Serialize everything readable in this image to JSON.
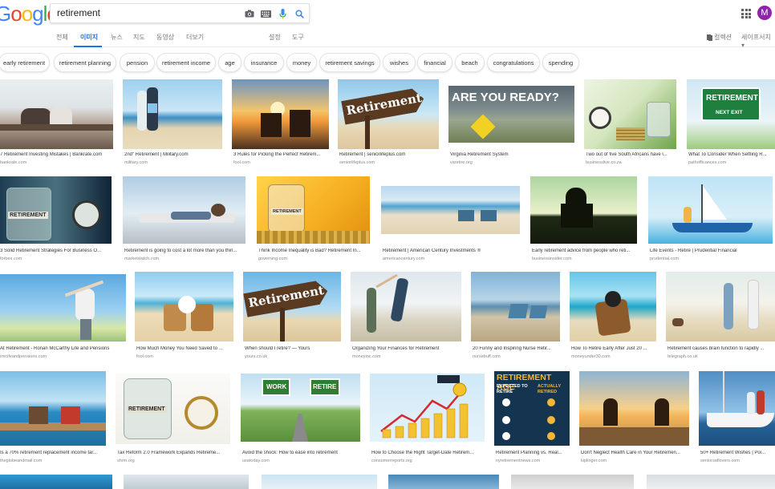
{
  "logo": "Google",
  "search": {
    "value": "retirement"
  },
  "avatar_letter": "M",
  "tabs": [
    "전체",
    "이미지",
    "뉴스",
    "지도",
    "동영상",
    "더보기"
  ],
  "right_tabs": {
    "settings": "설정",
    "tools": "도구",
    "collections": "컬렉션",
    "safesearch": "세이프서치 ▾"
  },
  "chips": [
    "early retirement",
    "retirement planning",
    "pension",
    "retirement income",
    "age",
    "insurance",
    "money",
    "retirement savings",
    "wishes",
    "financial",
    "beach",
    "congratulations",
    "spending"
  ],
  "images": {
    "r1": [
      {
        "cap": "7 Retirement Investing Mistakes | Bankrate.com",
        "src": "bankrate.com"
      },
      {
        "cap": "2nd\" Retirement | Military.com",
        "src": "military.com"
      },
      {
        "cap": "3 Rules for Picking the Perfect Retirem...",
        "src": "fool.com"
      },
      {
        "cap": "Retirement | seniorlifeplus.com",
        "src": "seniorlifeplus.com",
        "text": "Retirement"
      },
      {
        "cap": "Virginia Retirement System",
        "src": "varetire.org",
        "text": "ARE YOU READY?"
      },
      {
        "cap": "Two out of five South Africans have l...",
        "src": "businesslive.co.za"
      },
      {
        "cap": "What To Consider When Settling R...",
        "src": "pathofficances.com",
        "text": "RETIREMENT",
        "text2": "NEXT EXIT"
      }
    ],
    "r2": [
      {
        "cap": "3 Solid Retirement Strategies For Business O...",
        "src": "forbes.com",
        "text": "RETIREMENT"
      },
      {
        "cap": "Retirement is going to cost a lot more than you thin...",
        "src": "marketwatch.com"
      },
      {
        "cap": "Think Income Inequality is Bad? Retirement In...",
        "src": "governing.com",
        "text": "RETIREMENT"
      },
      {
        "cap": "Retirement | American Century Investments ®",
        "src": "americancentury.com"
      },
      {
        "cap": "Early retirement advice from people who reti...",
        "src": "businessinsider.com"
      },
      {
        "cap": "Life Events - Retire | Prudential Financial",
        "src": "prudential.com"
      }
    ],
    "r3": [
      {
        "cap": "At Retirement - Ronan McCarthy Life and Pensions",
        "src": "rmcifeandpensions.com"
      },
      {
        "cap": "How Much Money You Need Saved to ...",
        "src": "fool.com"
      },
      {
        "cap": "When should I retire? — Yours",
        "src": "yours.co.uk",
        "text": "Retirement"
      },
      {
        "cap": "Organizing Your Finances for Retirement",
        "src": "moneyinc.com"
      },
      {
        "cap": "20 Funny and Inspiring Nurse Retir...",
        "src": "nursebuff.com"
      },
      {
        "cap": "How To Retire Early After Just 20 ...",
        "src": "moneyunder30.com"
      },
      {
        "cap": "Retirement causes brain function to rapidly ...",
        "src": "telegraph.co.uk"
      }
    ],
    "r4": [
      {
        "cap": "Is a 70% retirement replacement income tar...",
        "src": "thegiobeandmail.com"
      },
      {
        "cap": "Tax Reform 2.0 Framework Expands Retireme...",
        "src": "shrm.org",
        "text": "RETIREMENT"
      },
      {
        "cap": "Avoid the shock: How to ease into retirement",
        "src": "usatoday.com",
        "text": "WORK",
        "text2": "RETIRE"
      },
      {
        "cap": "How to Choose the Right Target-Date Retirem...",
        "src": "consumerreports.org"
      },
      {
        "cap": "Retirement Planning vs. Real...",
        "src": "nyretirementnews.com",
        "text": "RETIREMENT AGE",
        "text2": "EXPECTED TO RETIRE",
        "text3": "ACTUALLY RETIRED"
      },
      {
        "cap": "Don't Neglect Health Care in Your Retiremen...",
        "src": "kiplinger.com"
      },
      {
        "cap": "50+ Retirement Wishes | Poi...",
        "src": "seniorsaflovers.com"
      }
    ]
  },
  "colors": {
    "accent": "#1a73e8",
    "avatar": "#8e24aa"
  }
}
